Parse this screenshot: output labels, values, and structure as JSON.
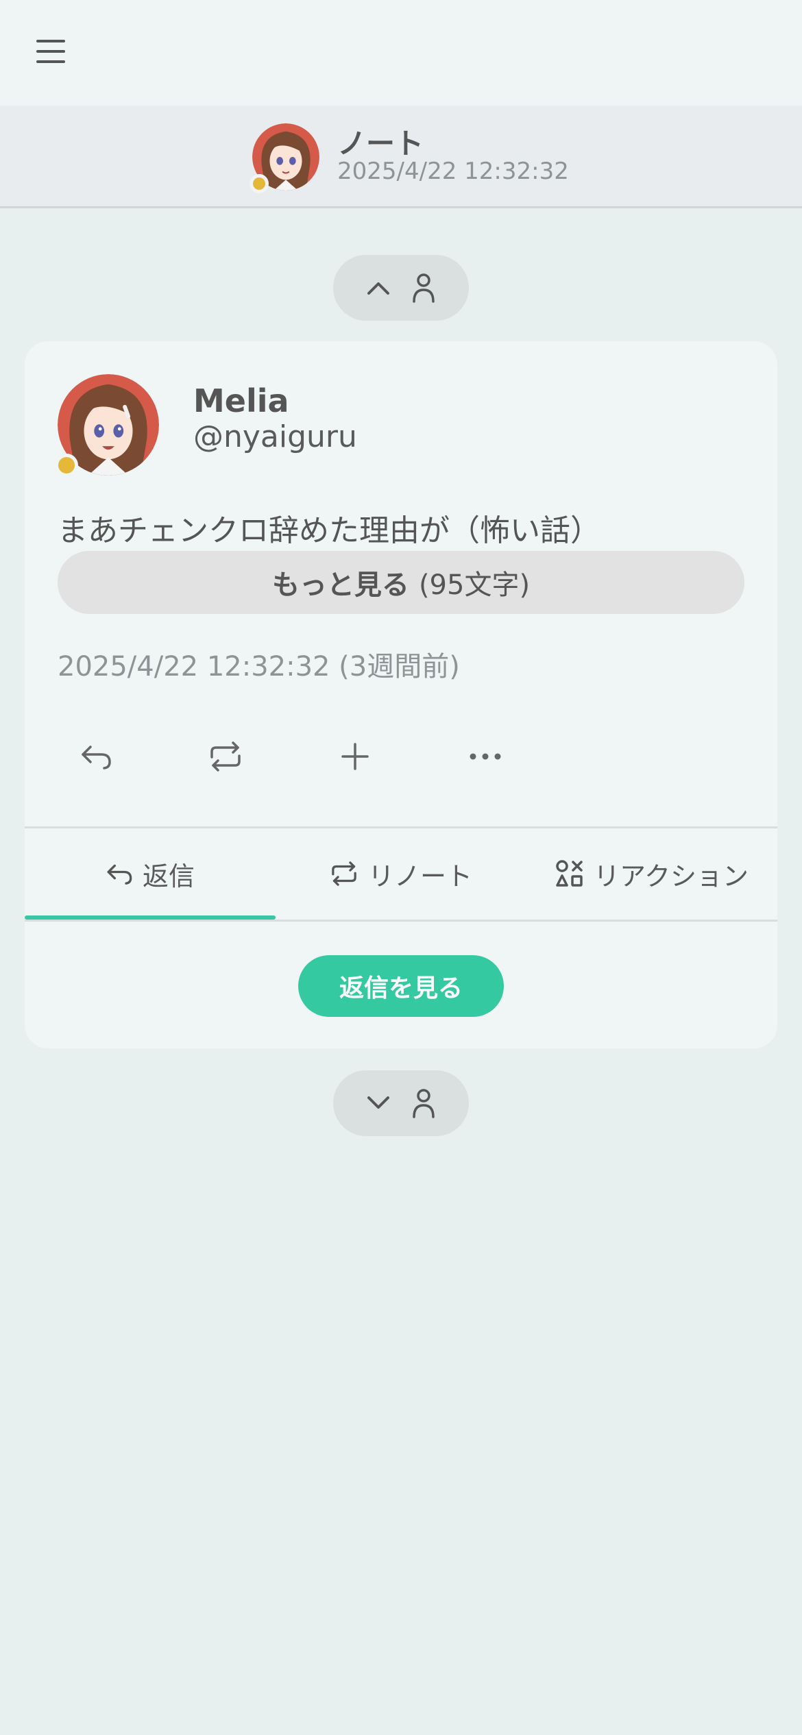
{
  "header": {
    "title": "ノート",
    "subtitle": "2025/4/22 12:32:32"
  },
  "note": {
    "author_name": "Melia",
    "author_handle": "@nyaiguru",
    "text": "まあチェンクロ辞めた理由が（怖い話）",
    "show_more_label": "もっと見る",
    "show_more_count": "(95文字)",
    "timestamp": "2025/4/22 12:32:32 (3週間前)"
  },
  "tabs": [
    {
      "label": "返信",
      "icon": "reply-icon",
      "active": true
    },
    {
      "label": "リノート",
      "icon": "renote-icon",
      "active": false
    },
    {
      "label": "リアクション",
      "icon": "reactions-icon",
      "active": false
    }
  ],
  "see_replies_label": "返信を見る",
  "colors": {
    "accent": "#35c9a2",
    "status": "#e6b83a",
    "background": "#e8f0ef"
  }
}
